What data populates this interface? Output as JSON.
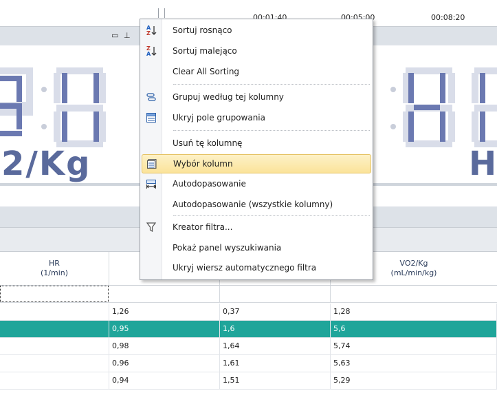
{
  "timeline": {
    "ticks": [
      "00:01:40",
      "00:05:00",
      "00:08:20"
    ]
  },
  "display": {
    "left_unit": "2/Kg",
    "right_unit": "H"
  },
  "grid": {
    "columns": [
      {
        "name": "HR",
        "unit": "(1/min)"
      },
      {
        "name": "",
        "unit": ""
      },
      {
        "name": "",
        "unit": ""
      },
      {
        "name": "VO2/Kg",
        "unit": "(mL/min/kg)"
      }
    ],
    "rows": [
      [
        "",
        "1,26",
        "0,37",
        "1,28"
      ],
      [
        "",
        "0,95",
        "1,6",
        "5,6"
      ],
      [
        "",
        "0,98",
        "1,64",
        "5,74"
      ],
      [
        "",
        "0,96",
        "1,61",
        "5,63"
      ],
      [
        "",
        "0,94",
        "1,51",
        "5,29"
      ]
    ],
    "selected_row": 1,
    "selection_color": "#1fa59a"
  },
  "menu": {
    "items": [
      {
        "label": "Sortuj rosnąco",
        "icon": "sort-ascending-icon"
      },
      {
        "label": "Sortuj malejąco",
        "icon": "sort-descending-icon"
      },
      {
        "label": "Clear All Sorting",
        "icon": ""
      },
      {
        "label": "Grupuj według tej kolumny",
        "icon": "group-by-icon"
      },
      {
        "label": "Ukryj pole grupowania",
        "icon": "group-panel-icon"
      },
      {
        "label": "Usuń tę kolumnę",
        "icon": ""
      },
      {
        "label": "Wybór kolumn",
        "icon": "column-chooser-icon"
      },
      {
        "label": "Autodopasowanie",
        "icon": "best-fit-icon"
      },
      {
        "label": "Autodopasowanie (wszystkie kolumny)",
        "icon": ""
      },
      {
        "label": "Kreator filtra...",
        "icon": "filter-icon"
      },
      {
        "label": "Pokaż panel wyszukiwania",
        "icon": ""
      },
      {
        "label": "Ukryj wiersz automatycznego filtra",
        "icon": ""
      }
    ],
    "highlighted_index": 6,
    "highlight_color": "#fbe39a"
  }
}
